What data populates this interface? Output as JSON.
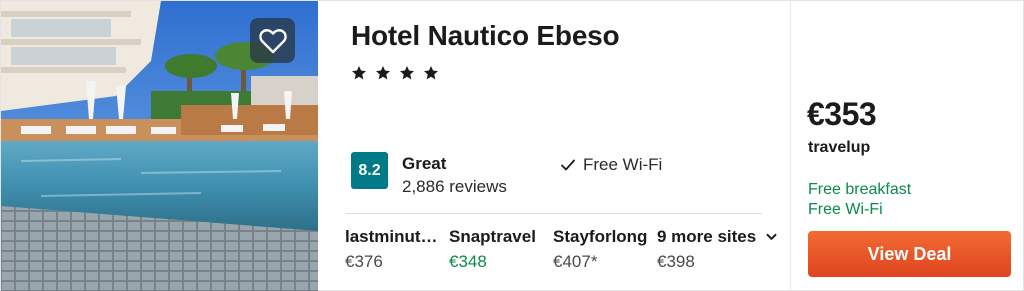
{
  "hotel": {
    "name": "Hotel Nautico Ebeso",
    "stars": 4
  },
  "rating": {
    "score": "8.2",
    "label": "Great",
    "reviews": "2,886 reviews",
    "badge_color": "#007a87"
  },
  "amenity": {
    "label": "Free Wi-Fi",
    "icon": "check-icon"
  },
  "prices": [
    {
      "site": "lastminut…",
      "price": "€376",
      "best": false
    },
    {
      "site": "Snaptravel",
      "price": "€348",
      "best": true
    },
    {
      "site": "Stayforlong",
      "price": "€407*",
      "best": false
    }
  ],
  "more_sites": {
    "label": "9 more sites",
    "price": "€398",
    "icon": "chevron-down-icon"
  },
  "deal": {
    "price": "€353",
    "provider": "travelup",
    "perks": [
      "Free breakfast",
      "Free Wi-Fi"
    ],
    "button_label": "View Deal",
    "button_color": "#e8552a",
    "perk_color": "#0a8a4c"
  },
  "favorite": {
    "icon": "heart-icon"
  }
}
